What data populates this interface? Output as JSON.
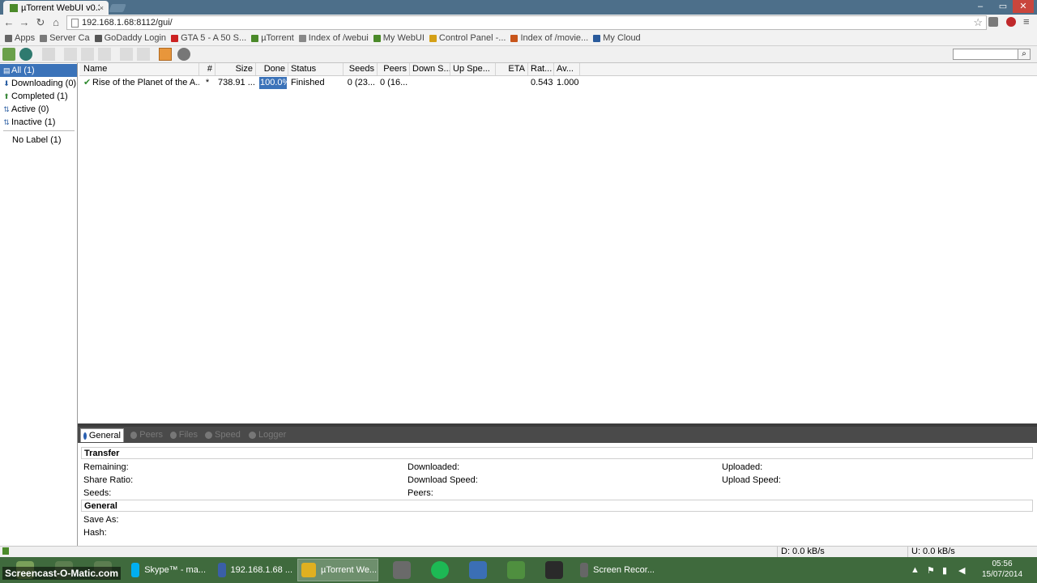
{
  "browser": {
    "tab_title": "µTorrent WebUI v0.3",
    "tab_close": "×",
    "url": "192.168.1.68:8112/gui/",
    "bookmarks": [
      {
        "label": "Apps",
        "color": "#666666"
      },
      {
        "label": "Server Ca",
        "color": "#7a7a7a"
      },
      {
        "label": "GoDaddy Login",
        "color": "#555555"
      },
      {
        "label": "GTA 5 - A  50 S...",
        "color": "#cc2222"
      },
      {
        "label": "µTorrent",
        "color": "#4b8a2a"
      },
      {
        "label": "Index of /webui",
        "color": "#888888"
      },
      {
        "label": "My WebUI",
        "color": "#4b8a2a"
      },
      {
        "label": "Control Panel -...",
        "color": "#d4a017"
      },
      {
        "label": "Index of /movie...",
        "color": "#c8551b"
      },
      {
        "label": "My Cloud",
        "color": "#2a5b9c"
      }
    ]
  },
  "sidebar": {
    "categories": [
      {
        "label": "All (1)",
        "icon": "all-icon",
        "glyph": "▤"
      },
      {
        "label": "Downloading (0)",
        "icon": "download-arrow-icon",
        "glyph": "⬇"
      },
      {
        "label": "Completed (1)",
        "icon": "completed-arrow-icon",
        "glyph": "⬆"
      },
      {
        "label": "Active (0)",
        "icon": "active-icon",
        "glyph": "⇅"
      },
      {
        "label": "Inactive (1)",
        "icon": "inactive-icon",
        "glyph": "⇅"
      }
    ],
    "labels": [
      {
        "label": "No Label (1)"
      }
    ]
  },
  "table": {
    "columns": [
      "Name",
      "#",
      "Size",
      "Done",
      "Status",
      "Seeds",
      "Peers",
      "Down S...",
      "Up Spe...",
      "ETA",
      "Rat...",
      "Av..."
    ],
    "rows": [
      {
        "name": "Rise of the Planet of the A...",
        "num": "*",
        "size": "738.91 ...",
        "done": "100.0%",
        "status": "Finished",
        "seeds": "0 (23...",
        "peers": "0 (16...",
        "down": "",
        "up": "",
        "eta": "",
        "ratio": "0.543",
        "avail": "1.000"
      }
    ]
  },
  "details": {
    "tabs": [
      {
        "label": "General",
        "icon": "info-icon"
      },
      {
        "label": "Peers",
        "icon": "peers-icon"
      },
      {
        "label": "Files",
        "icon": "files-icon"
      },
      {
        "label": "Speed",
        "icon": "speed-icon"
      },
      {
        "label": "Logger",
        "icon": "logger-icon"
      }
    ],
    "transfer_heading": "Transfer",
    "general_heading": "General",
    "fields": {
      "remaining": "Remaining:",
      "downloaded": "Downloaded:",
      "uploaded": "Uploaded:",
      "share_ratio": "Share Ratio:",
      "download_speed": "Download Speed:",
      "upload_speed": "Upload Speed:",
      "seeds": "Seeds:",
      "peers": "Peers:",
      "save_as": "Save As:",
      "hash": "Hash:"
    }
  },
  "statusbar": {
    "down": "D: 0.0 kB/s",
    "up": "U: 0.0 kB/s"
  },
  "taskbar": {
    "watermark": "Screencast-O-Matic.com",
    "tasks": [
      {
        "label": "Skype™ - ma...",
        "color": "#00aff0"
      },
      {
        "label": "192.168.1.68 ...",
        "color": "#3a5fa8"
      },
      {
        "label": "µTorrent We...",
        "color": "#e0b020"
      },
      {
        "label": "Screen Recor...",
        "color": "#666666"
      }
    ],
    "time": "05:56",
    "date": "15/07/2014"
  }
}
